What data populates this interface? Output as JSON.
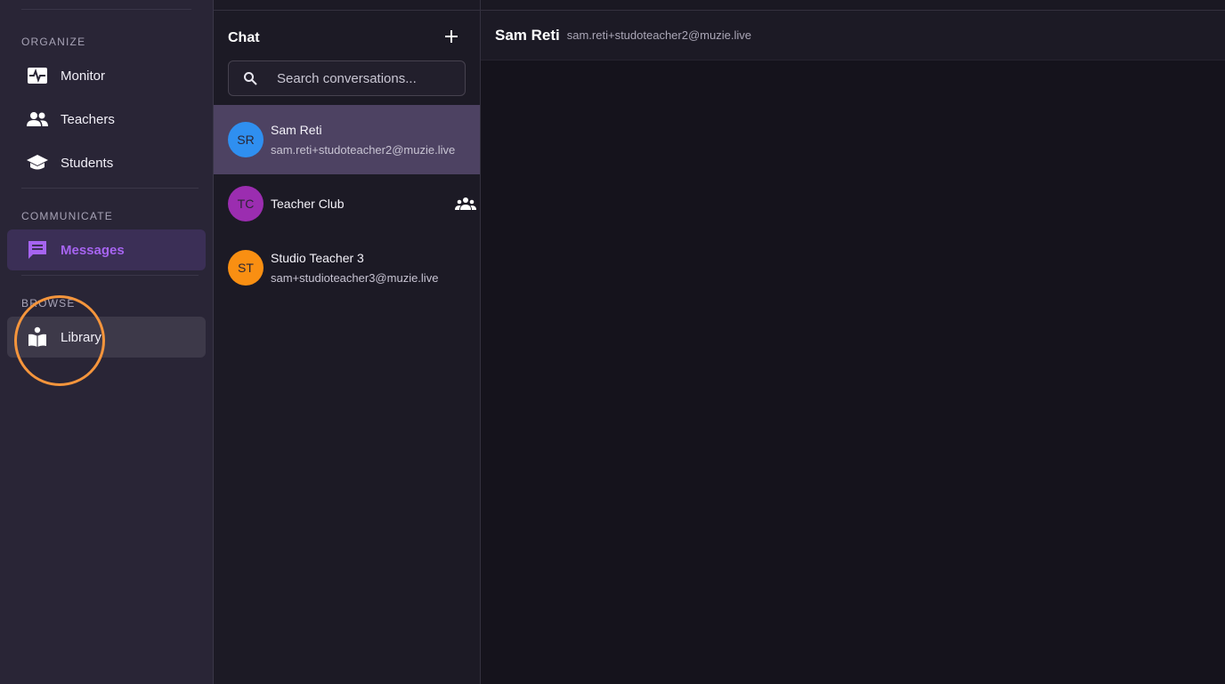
{
  "sidebar": {
    "sections": [
      {
        "label": "ORGANIZE"
      },
      {
        "label": "COMMUNICATE"
      },
      {
        "label": "BROWSE"
      }
    ],
    "items": [
      {
        "label": "Monitor",
        "icon": "monitor-heart-icon"
      },
      {
        "label": "Teachers",
        "icon": "people-icon"
      },
      {
        "label": "Students",
        "icon": "school-icon"
      },
      {
        "label": "Messages",
        "icon": "chat-bubble-icon"
      },
      {
        "label": "Library",
        "icon": "reading-book-icon"
      }
    ],
    "active_item": "Messages",
    "accent_color": "#a664f0"
  },
  "chat": {
    "title": "Chat",
    "search_placeholder": "Search conversations...",
    "conversations": [
      {
        "initials": "SR",
        "name": "Sam Reti",
        "email": "sam.reti+studoteacher2@muzie.live",
        "avatar_color": "#2f8ff0",
        "selected": true
      },
      {
        "initials": "TC",
        "name": "Teacher Club",
        "email": "",
        "avatar_color": "#9b2db0",
        "group": true
      },
      {
        "initials": "ST",
        "name": "Studio Teacher 3",
        "email": "sam+studioteacher3@muzie.live",
        "avatar_color": "#f98f12"
      }
    ]
  },
  "main": {
    "header_name": "Sam Reti",
    "header_email": "sam.reti+studoteacher2@muzie.live"
  }
}
